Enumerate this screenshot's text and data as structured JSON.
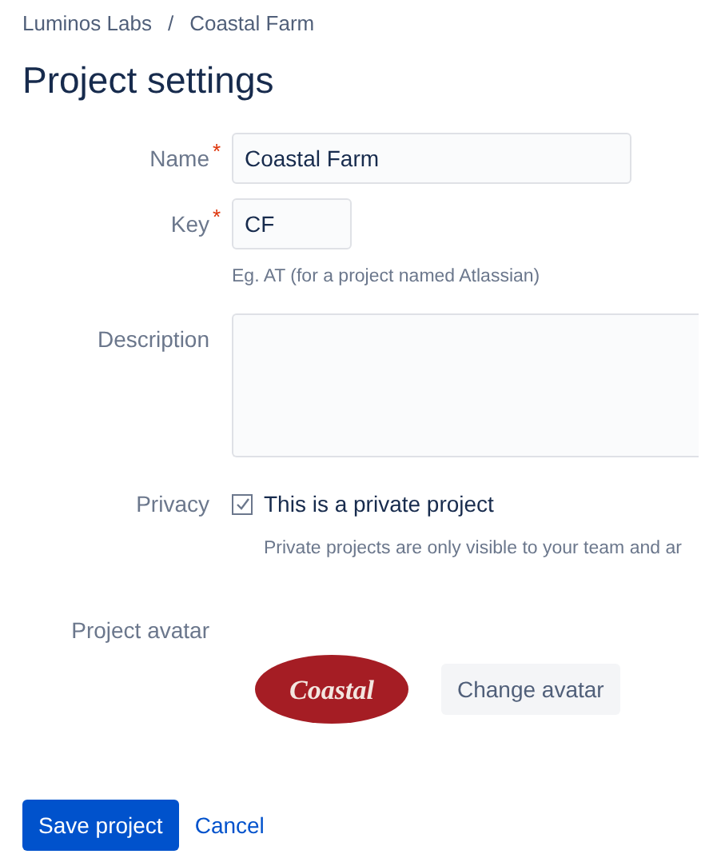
{
  "breadcrumbs": [
    "Luminos Labs",
    "Coastal Farm"
  ],
  "breadcrumb_separator": "/",
  "title": "Project settings",
  "fields": [
    {
      "kind": "input",
      "label": "Name",
      "required": true,
      "value": "Coastal Farm"
    },
    {
      "kind": "input",
      "label": "Key",
      "required": true,
      "value": "CF",
      "hint": "Eg. AT (for a project named Atlassian)"
    },
    {
      "kind": "textarea",
      "label": "Description",
      "required": false
    },
    {
      "kind": "checkbox",
      "label": "Privacy",
      "required": false,
      "option": "This is a private project",
      "checked": true,
      "hint": "Private projects are only visible to your team and ar"
    }
  ],
  "required_mark": "*",
  "avatar": {
    "label": "Project avatar",
    "logo_text": "Coastal",
    "button": "Change avatar"
  },
  "actions": {
    "primary": "Save project",
    "secondary": "Cancel"
  }
}
